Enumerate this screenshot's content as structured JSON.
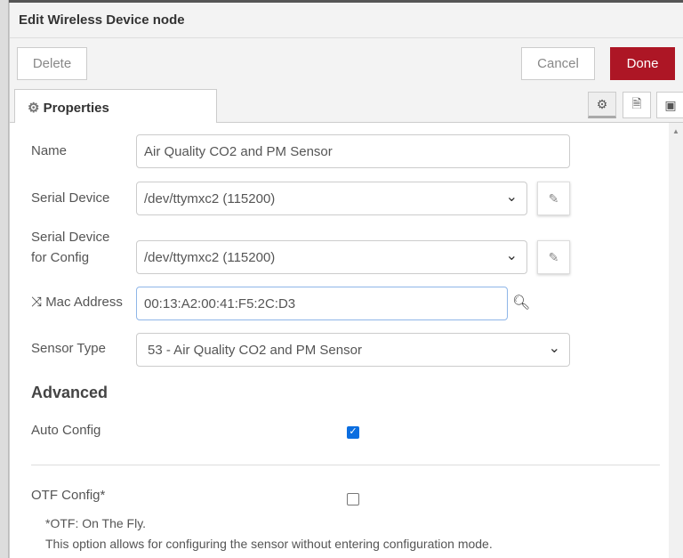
{
  "dialog": {
    "title": "Edit Wireless Device node"
  },
  "buttons": {
    "delete": "Delete",
    "cancel": "Cancel",
    "done": "Done"
  },
  "tabs": {
    "properties": "Properties"
  },
  "form": {
    "name_label": "Name",
    "name_value": "Air Quality CO2 and PM Sensor",
    "serial_label": "Serial Device",
    "serial_value": "/dev/ttymxc2 (115200)",
    "serial_config_label_1": "Serial Device",
    "serial_config_label_2": "for Config",
    "serial_config_value": "/dev/ttymxc2 (115200)",
    "mac_label": "Mac Address",
    "mac_value": "00:13:A2:00:41:F5:2C:D3",
    "sensor_label": "Sensor Type",
    "sensor_value": "53 - Air Quality CO2 and PM Sensor",
    "advanced": "Advanced",
    "auto_config_label": "Auto Config",
    "auto_config_checked": true,
    "otf_label": "OTF Config*",
    "otf_checked": false,
    "otf_note_1": "*OTF: On The Fly.",
    "otf_note_2": "This option allows for configuring the sensor without entering configuration mode."
  },
  "colors": {
    "done": "#ad1625",
    "checkbox": "#0b6ee0"
  }
}
